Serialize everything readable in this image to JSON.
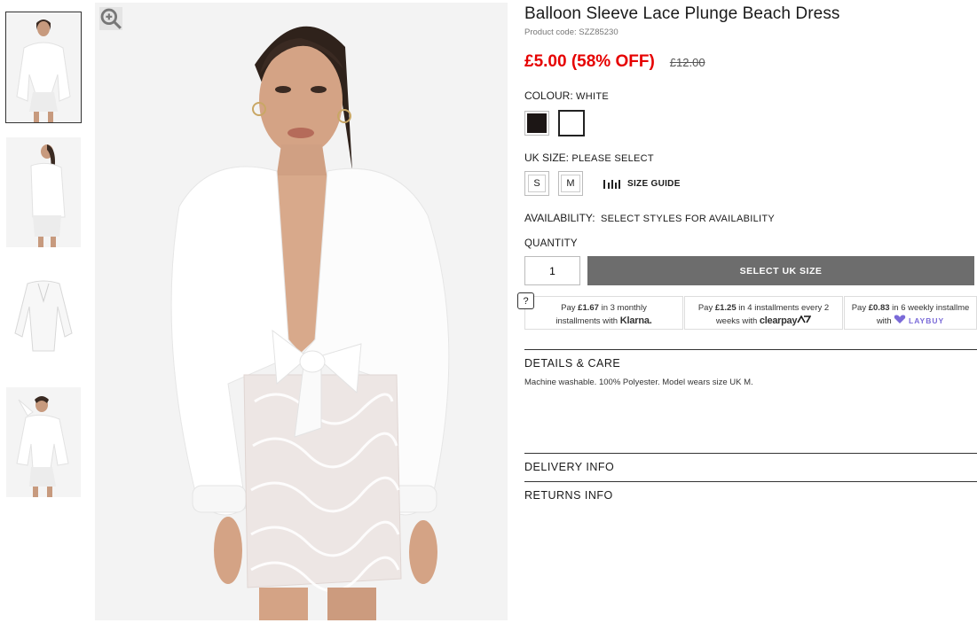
{
  "product": {
    "title": "Balloon Sleeve Lace Plunge Beach Dress",
    "code": "Product code: SZZ85230",
    "price": "£5.00 (58% OFF)",
    "was_price": "£12.00"
  },
  "colour": {
    "label": "COLOUR:",
    "value": "WHITE",
    "options": [
      {
        "name": "black",
        "hex": "#1c1615"
      },
      {
        "name": "white",
        "hex": "#ffffff"
      }
    ]
  },
  "size": {
    "label": "UK SIZE:",
    "value": "PLEASE SELECT",
    "options": [
      "S",
      "M"
    ],
    "guide": "SIZE GUIDE"
  },
  "availability": {
    "label": "AVAILABILITY:",
    "value": "SELECT STYLES FOR AVAILABILITY"
  },
  "quantity": {
    "label": "QUANTITY",
    "value": "1"
  },
  "cta": {
    "label": "SELECT UK SIZE",
    "color": "#6d6d6d"
  },
  "payments": {
    "help": "?",
    "klarna": {
      "pre": "Pay ",
      "amount": "£1.67",
      "mid": " in 3 monthly",
      "line2": "installments with ",
      "brand": "Klarna."
    },
    "clearpay": {
      "pre": "Pay ",
      "amount": "£1.25",
      "mid": " in 4 installments every 2",
      "line2": "weeks with ",
      "brand": "clearpay"
    },
    "laybuy": {
      "pre": "Pay ",
      "amount": "£0.83",
      "mid": " in 6 weekly installme",
      "line2": "with ",
      "brand": "LAYBUY"
    }
  },
  "details": {
    "title": "DETAILS & CARE",
    "text": "Machine washable. 100% Polyester. Model wears size UK M."
  },
  "delivery": {
    "title": "DELIVERY INFO"
  },
  "returns": {
    "title": "RETURNS INFO"
  },
  "accent": "#e60000"
}
